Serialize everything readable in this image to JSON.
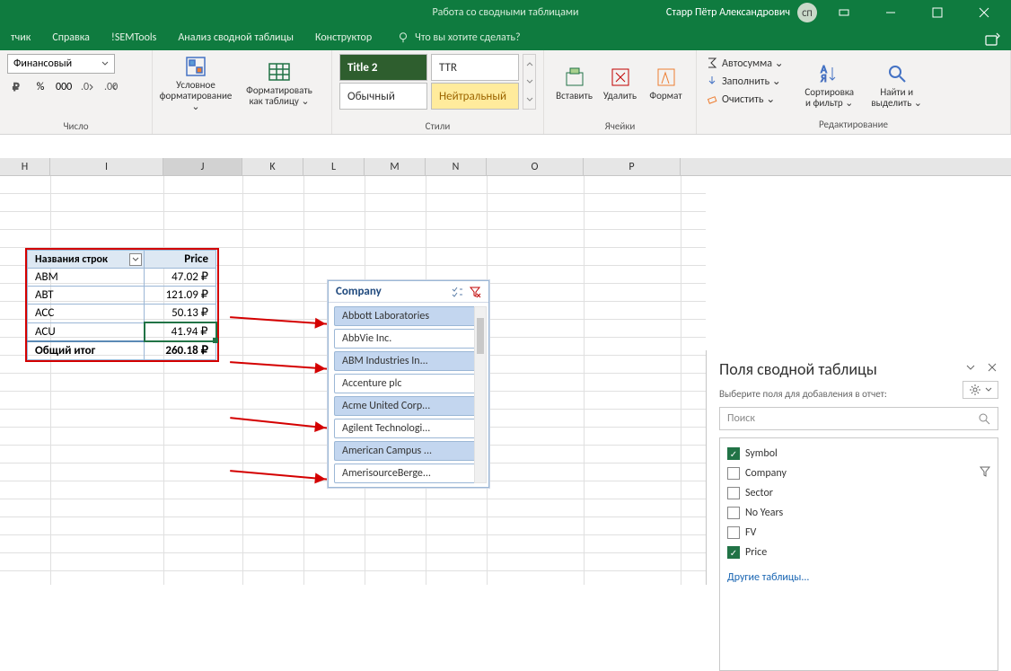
{
  "title_bar": {
    "context": "Работа со сводными таблицами",
    "user": "Старр Пётр Александрович",
    "initials": "СП"
  },
  "tabs": {
    "items": [
      "тчик",
      "Справка",
      "!SEMTools",
      "Анализ сводной таблицы",
      "Конструктор"
    ],
    "tell_me": "Что вы хотите сделать?"
  },
  "ribbon": {
    "number": {
      "format": "Финансовый",
      "group": "Число"
    },
    "cond_format": "Условное\nформатирование ⌄",
    "format_table": "Форматировать\nкак таблицу ⌄",
    "styles": {
      "title2": "Title 2",
      "ttr": "TTR",
      "normal": "Обычный",
      "neutral": "Нейтральный",
      "group": "Стили"
    },
    "cells": {
      "insert": "Вставить",
      "delete": "Удалить",
      "format": "Формат",
      "group": "Ячейки"
    },
    "edit": {
      "autosum": "Автосумма ⌄",
      "fill": "Заполнить ⌄",
      "clear": "Очистить ⌄",
      "sort": "Сортировка\nи фильтр ⌄",
      "find": "Найти и\nвыделить ⌄",
      "group": "Редактирование"
    }
  },
  "columns": [
    "H",
    "I",
    "J",
    "K",
    "L",
    "M",
    "N",
    "O",
    "P"
  ],
  "pivot": {
    "row_label": "Названия строк",
    "price_label": "Price",
    "rows": [
      {
        "name": "ABM",
        "price": "47.02 ₽"
      },
      {
        "name": "ABT",
        "price": "121.09 ₽"
      },
      {
        "name": "ACC",
        "price": "50.13 ₽"
      },
      {
        "name": "ACU",
        "price": "41.94 ₽"
      }
    ],
    "total_label": "Общий итог",
    "total": "260.18 ₽"
  },
  "slicer": {
    "title": "Company",
    "items": [
      {
        "label": "Abbott Laboratories",
        "sel": true
      },
      {
        "label": "AbbVie Inc.",
        "sel": false
      },
      {
        "label": "ABM Industries In...",
        "sel": true
      },
      {
        "label": "Accenture plc",
        "sel": false
      },
      {
        "label": "Acme United Corp...",
        "sel": true
      },
      {
        "label": "Agilent Technologi...",
        "sel": false
      },
      {
        "label": "American Campus ...",
        "sel": true
      },
      {
        "label": "AmerisourceBerge...",
        "sel": false
      }
    ]
  },
  "fields": {
    "title": "Поля сводной таблицы",
    "sub": "Выберите поля для добавления в отчет:",
    "search": "Поиск",
    "items": [
      {
        "label": "Symbol",
        "checked": true,
        "filter": false
      },
      {
        "label": "Company",
        "checked": false,
        "filter": true
      },
      {
        "label": "Sector",
        "checked": false,
        "filter": false
      },
      {
        "label": "No Years",
        "checked": false,
        "filter": false
      },
      {
        "label": "FV",
        "checked": false,
        "filter": false
      },
      {
        "label": "Price",
        "checked": true,
        "filter": false
      }
    ],
    "other": "Другие таблицы..."
  }
}
